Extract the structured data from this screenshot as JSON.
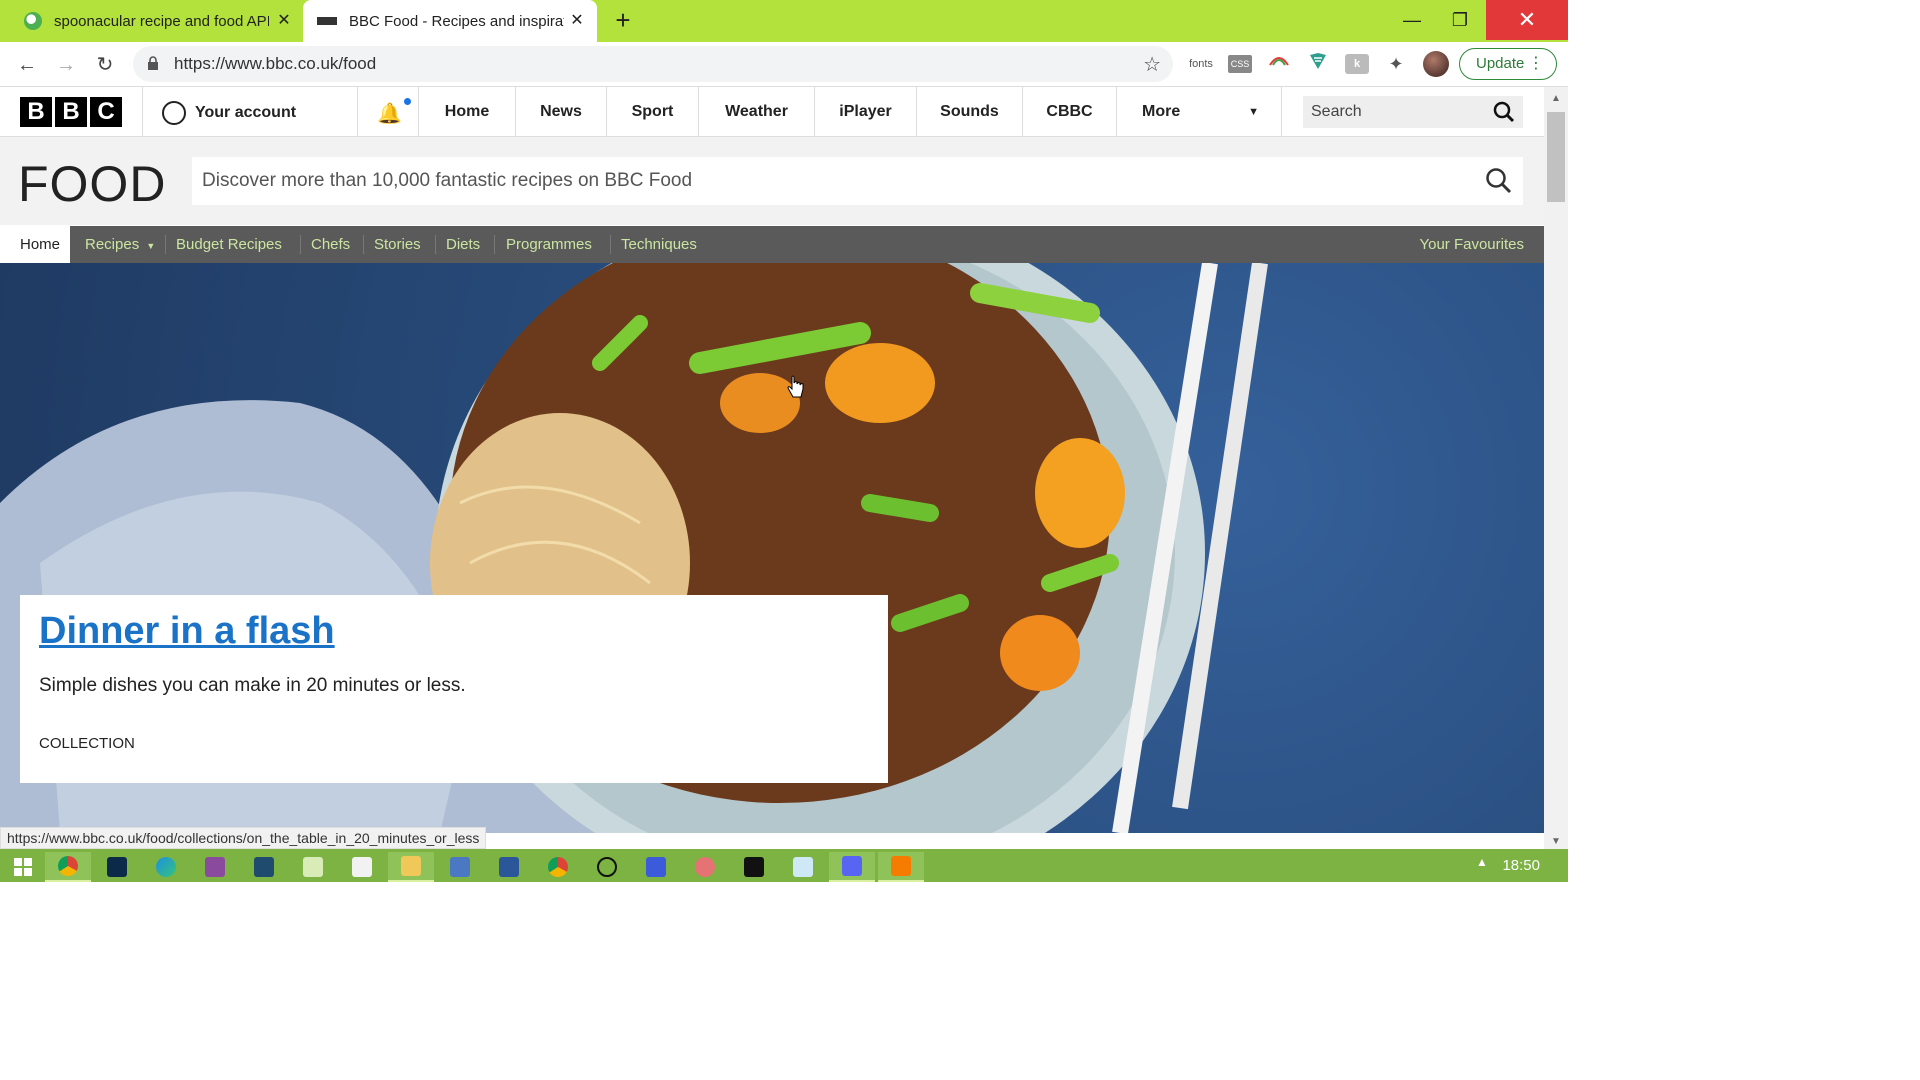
{
  "browser": {
    "tabs": [
      {
        "title": "spoonacular recipe and food API",
        "active": false,
        "icon": "spoonacular-favicon"
      },
      {
        "title": "BBC Food - Recipes and inspiratio",
        "active": true,
        "icon": "bbc-favicon"
      }
    ],
    "new_tab": "+",
    "url": "https://www.bbc.co.uk/food",
    "extensions": [
      "fonts",
      "css-icon",
      "rainbow-icon",
      "shield-icon",
      "k-icon",
      "puzzle-icon"
    ],
    "update_label": "Update",
    "status_url": "https://www.bbc.co.uk/food/collections/on_the_table_in_20_minutes_or_less"
  },
  "bbc_header": {
    "logo_letters": [
      "B",
      "B",
      "C"
    ],
    "account_label": "Your account",
    "nav": [
      "Home",
      "News",
      "Sport",
      "Weather",
      "iPlayer",
      "Sounds",
      "CBBC",
      "More"
    ],
    "search_placeholder": "Search"
  },
  "food": {
    "logo": "FOOD",
    "search_placeholder": "Discover more than 10,000 fantastic recipes on BBC Food",
    "subnav": [
      "Home",
      "Recipes",
      "Budget Recipes",
      "Chefs",
      "Stories",
      "Diets",
      "Programmes",
      "Techniques"
    ],
    "favourites": "Your Favourites"
  },
  "hero": {
    "title": "Dinner in a flash",
    "description": "Simple dishes you can make in 20 minutes or less.",
    "type": "COLLECTION"
  },
  "taskbar": {
    "clock": "18:50",
    "apps": [
      "start-icon",
      "chrome-icon",
      "photoshop-icon",
      "edge-icon",
      "onenote-icon",
      "app-icon",
      "notepad-icon",
      "reader-icon",
      "explorer-icon",
      "remote-icon",
      "word-icon",
      "chrome-alt-icon",
      "speech-icon",
      "settings-icon",
      "paint-icon",
      "terminal-icon",
      "app2-icon",
      "discord-icon",
      "media-icon"
    ]
  },
  "colors": {
    "tabstrip": "#b2e23b",
    "taskbar": "#7cb342",
    "link": "#1a73c7",
    "subnav_bg": "#5a5a5a",
    "subnav_text": "#cbe6a0"
  }
}
